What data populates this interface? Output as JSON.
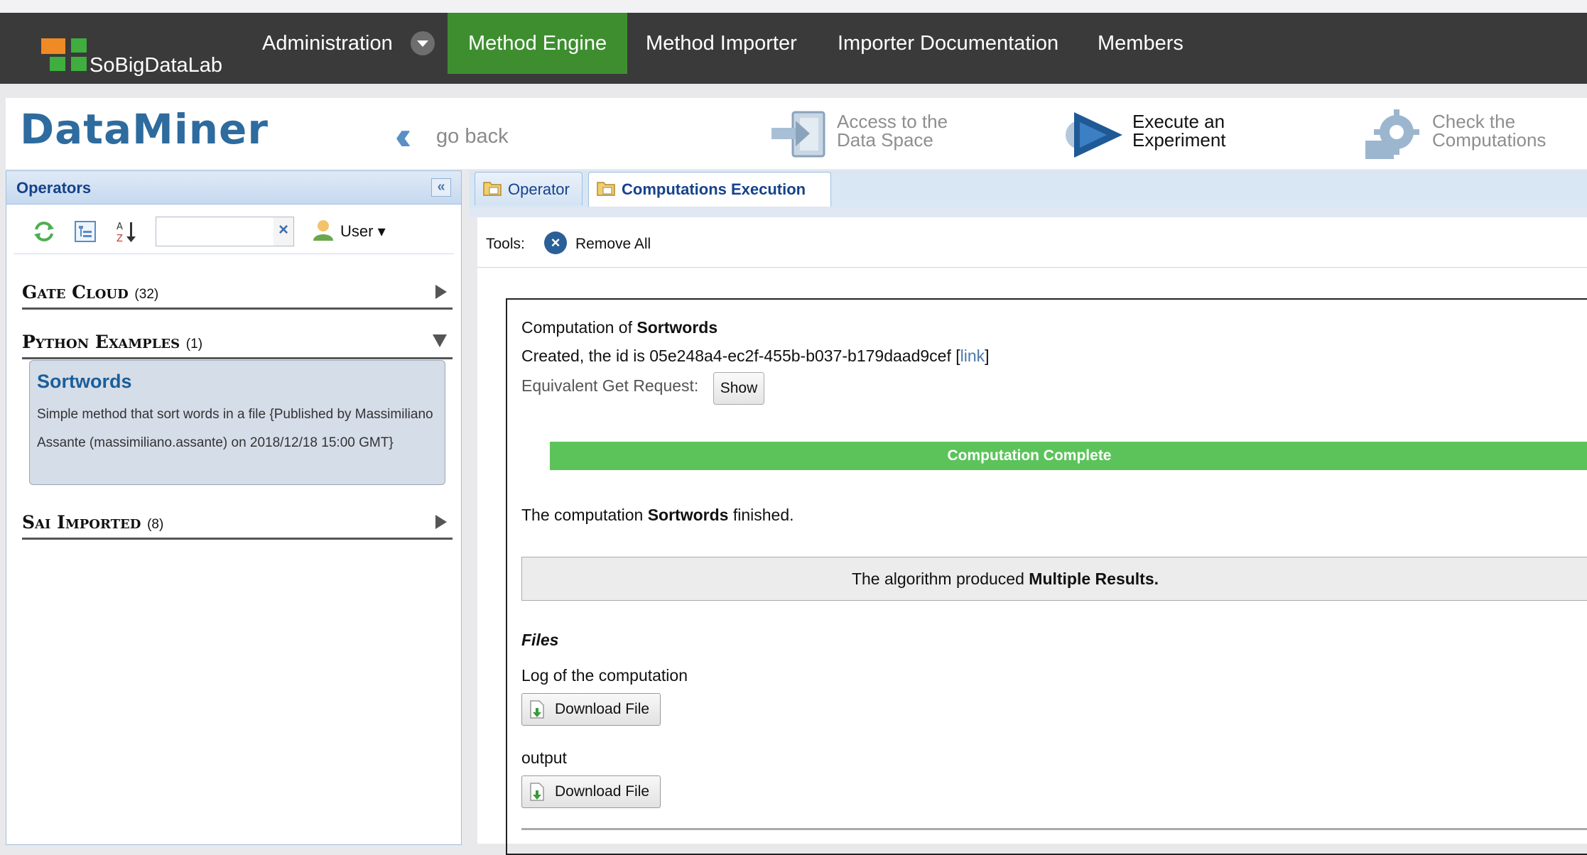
{
  "app": {
    "brand_name": "SoBigDataLab",
    "brand_colors": {
      "orange": "#f08a24",
      "green": "#3fae3f"
    }
  },
  "nav": {
    "items": [
      {
        "label": "Administration"
      },
      {
        "label": "Method Engine"
      },
      {
        "label": "Method Importer"
      },
      {
        "label": "Importer Documentation"
      },
      {
        "label": "Members"
      }
    ],
    "active_color": "#3e8e30"
  },
  "header": {
    "logo_text": "DataMiner",
    "go_back": "go back",
    "access_data_space": {
      "line1": "Access to the",
      "line2": "Data Space",
      "icon": "data-space-icon"
    },
    "execute_experiment": {
      "line1": "Execute an",
      "line2": "Experiment",
      "icon": "play-icon"
    },
    "check_computations": {
      "line1": "Check the",
      "line2": "Computations",
      "icon": "gear-icon"
    }
  },
  "operators_panel": {
    "title": "Operators",
    "search": {
      "value": ""
    },
    "user_menu": "User",
    "categories": [
      {
        "name": "Gate Cloud",
        "count": "(32)",
        "expanded": false
      },
      {
        "name": "Python Examples",
        "count": "(1)",
        "expanded": true
      },
      {
        "name": "Sai Imported",
        "count": "(8)",
        "expanded": false
      }
    ],
    "operator": {
      "name": "Sortwords",
      "description": "Simple method that sort words in a file {Published by Massimiliano Assante (massimiliano.assante) on 2018/12/18 15:00 GMT}"
    }
  },
  "tabs": [
    {
      "label": "Operator",
      "active": false
    },
    {
      "label": "Computations Execution",
      "active": true
    }
  ],
  "tools": {
    "label": "Tools:",
    "remove_all": "Remove All"
  },
  "computation": {
    "title_prefix": "Computation of",
    "name": "Sortwords",
    "created_prefix": "Created, the id is",
    "id": "05e248a4-ec2f-455b-b037-b179daad9cef",
    "link_label": "link",
    "get_request_label": "Equivalent Get Request:",
    "show_button": "Show",
    "status": "Computation Complete",
    "status_color": "#5cc35b",
    "progress": 1.0,
    "finished_prefix": "The computation",
    "finished_suffix": "finished.",
    "result_prefix": "The algorithm produced",
    "result_type": "Multiple Results.",
    "files_heading": "Files",
    "files": [
      {
        "label": "Log of the computation",
        "button": "Download File"
      },
      {
        "label": "output",
        "button": "Download File"
      }
    ]
  }
}
